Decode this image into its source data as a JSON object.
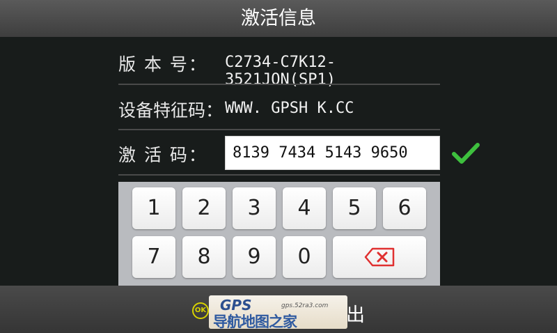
{
  "header": {
    "title": "激活信息"
  },
  "info": {
    "version_label": "版 本 号：",
    "version_value": "C2734-C7K12-3521JON(SP1)",
    "device_label": "设备特征码：",
    "device_value": "WWW. GPSH K.CC",
    "activation_label": "激 活 码：",
    "activation_value": "8139 7434 5143 9650"
  },
  "keypad": {
    "keys": [
      "1",
      "2",
      "3",
      "4",
      "5",
      "6",
      "7",
      "8",
      "9",
      "0"
    ],
    "backspace_icon": "backspace-icon"
  },
  "icons": {
    "confirm": "checkmark-icon",
    "ok": "ok-icon"
  },
  "footer": {
    "ok_badge": "OK",
    "exit_text": "出"
  },
  "watermark": {
    "logo": "GPS",
    "url": "gps.52ra3.com",
    "text": "导航地图之家"
  },
  "colors": {
    "check": "#3ec03e",
    "backspace": "#e03030",
    "ok": "#d8d200"
  }
}
